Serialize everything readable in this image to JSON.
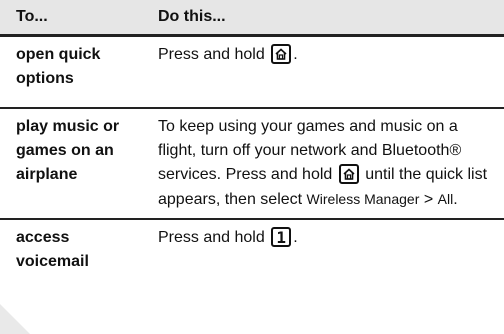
{
  "table": {
    "headers": {
      "col1": "To...",
      "col2": "Do this..."
    },
    "rows": [
      {
        "task": "open quick options",
        "action_pre": "Press and hold",
        "action_post": "."
      },
      {
        "task": "play music or games on an airplane",
        "action_pre": "To keep using your games and music on a flight, turn off your network and Bluetooth® services. Press and hold",
        "action_mid": "until the quick list appears, then select",
        "menu_item_1": "Wireless Manager",
        "separator": ">",
        "menu_item_2": "All",
        "action_post": "."
      },
      {
        "task": "access voicemail",
        "action_pre": "Press and hold",
        "key_label": "1",
        "action_post": "."
      }
    ]
  },
  "icons": {
    "home_key": "home-key-icon",
    "one_key": "one-key-icon"
  },
  "colors": {
    "header_bg": "#e6e6e6",
    "rule": "#222222"
  }
}
